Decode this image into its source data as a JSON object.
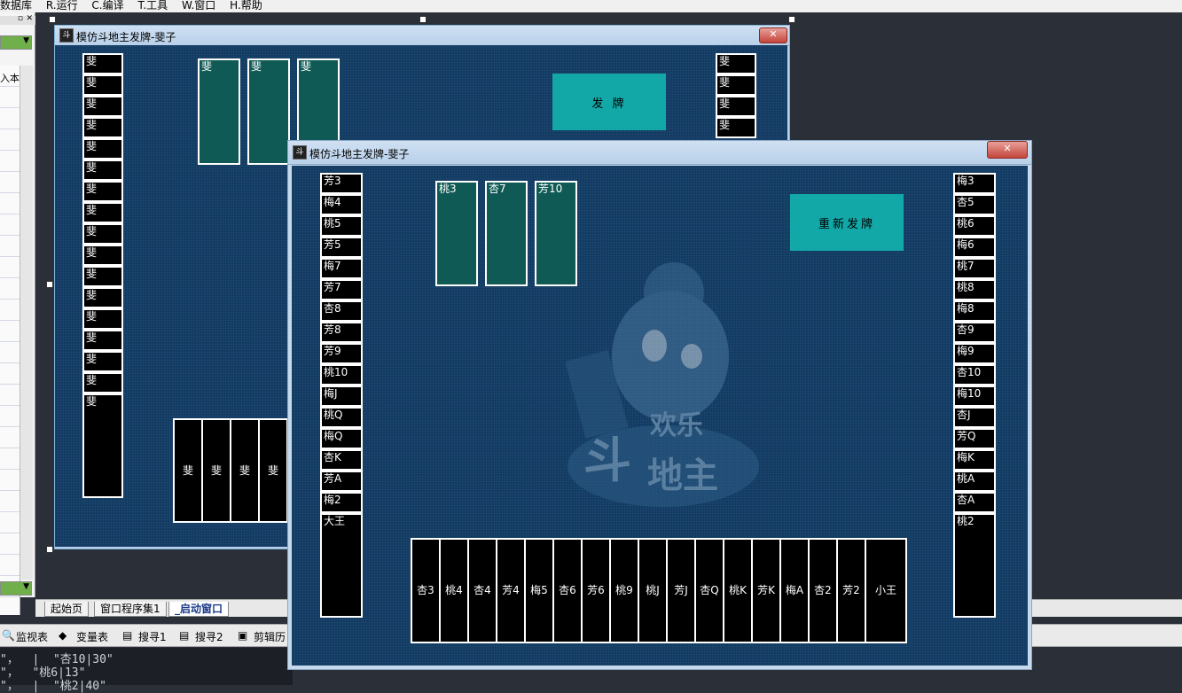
{
  "ide": {
    "menu": [
      "数据库",
      "R.运行",
      "C.编译",
      "T.工具",
      "W.窗口",
      "H.帮助"
    ],
    "left_panel_text": "入本",
    "tabs": [
      "起始页",
      "窗口程序集1",
      "_启动窗口"
    ],
    "toolbar": [
      "监视表",
      "变量表",
      "搜寻1",
      "搜寻2",
      "剪辑历"
    ],
    "console": [
      "\"，  |  \"杏10|30\"",
      "\"，  \"桃6|13\"",
      "\"，  |  \"桃2|40\""
    ]
  },
  "designer_window": {
    "title": "模仿斗地主发牌-斐子",
    "close": "✕",
    "button": "发   牌",
    "left_cards": [
      "斐",
      "斐",
      "斐",
      "斐",
      "斐",
      "斐",
      "斐",
      "斐",
      "斐",
      "斐",
      "斐",
      "斐",
      "斐",
      "斐",
      "斐",
      "斐"
    ],
    "left_last": "斐",
    "top_cards": [
      "斐",
      "斐",
      "斐"
    ],
    "right_cards": [
      "斐",
      "斐",
      "斐",
      "斐"
    ],
    "bottom_cards": [
      "斐",
      "斐",
      "斐",
      "斐"
    ]
  },
  "run_window": {
    "title": "模仿斗地主发牌-斐子",
    "close": "✕",
    "button": "重新发牌",
    "top_cards": [
      "桃3",
      "杏7",
      "芳10"
    ],
    "left_cards": [
      "芳3",
      "梅4",
      "桃5",
      "芳5",
      "梅7",
      "芳7",
      "杏8",
      "芳8",
      "芳9",
      "桃10",
      "梅J",
      "桃Q",
      "梅Q",
      "杏K",
      "芳A",
      "梅2"
    ],
    "left_last": "大王",
    "right_cards": [
      "梅3",
      "杏5",
      "桃6",
      "梅6",
      "桃7",
      "桃8",
      "梅8",
      "杏9",
      "梅9",
      "杏10",
      "梅10",
      "杏J",
      "芳Q",
      "梅K",
      "桃A",
      "杏A"
    ],
    "right_last": "桃2",
    "bottom_cards": [
      "杏3",
      "桃4",
      "杏4",
      "芳4",
      "梅5",
      "杏6",
      "芳6",
      "桃9",
      "桃J",
      "芳J",
      "杏Q",
      "桃K",
      "芳K",
      "梅A",
      "杏2",
      "芳2"
    ],
    "bottom_last": "小王",
    "mascot_text": [
      "欢乐",
      "斗",
      "地主"
    ]
  },
  "colors": {
    "felt": "#123b63",
    "teal_card": "#0f5a55",
    "button": "#13a8a8"
  }
}
